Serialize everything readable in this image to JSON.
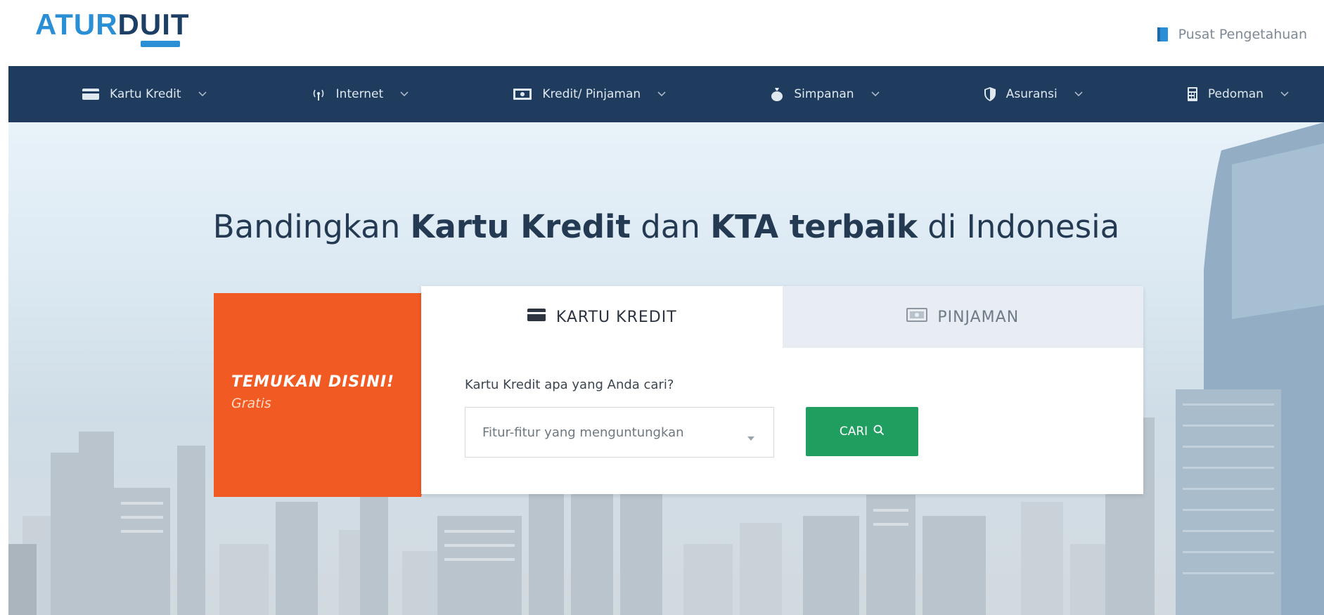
{
  "brand": {
    "logo_part1": "ATUR",
    "logo_part2": "DUIT",
    "link_label": "Pusat Pengetahuan"
  },
  "nav": {
    "items": [
      {
        "label": "Kartu Kredit",
        "icon": "credit-card-icon"
      },
      {
        "label": "Internet",
        "icon": "wifi-signal-icon"
      },
      {
        "label": "Kredit/ Pinjaman",
        "icon": "cash-icon"
      },
      {
        "label": "Simpanan",
        "icon": "money-bag-icon"
      },
      {
        "label": "Asuransi",
        "icon": "shield-icon"
      },
      {
        "label": "Pedoman",
        "icon": "calculator-icon"
      }
    ]
  },
  "hero": {
    "title_pre": "Bandingkan ",
    "title_bold1": "Kartu Kredit",
    "title_mid": " dan ",
    "title_bold2": "KTA terbaik",
    "title_post": " di Indonesia"
  },
  "search": {
    "banner_title": "TEMUKAN DISINI!",
    "banner_sub": "Gratis",
    "tabs": [
      {
        "label": "KARTU KREDIT",
        "icon": "credit-card-icon",
        "active": true
      },
      {
        "label": "PINJAMAN",
        "icon": "cash-icon",
        "active": false
      }
    ],
    "question": "Kartu Kredit apa yang Anda cari?",
    "select_value": "Fitur-fitur yang menguntungkan",
    "button_label": "CARI"
  },
  "colors": {
    "nav_bg": "#1f3c5e",
    "accent_orange": "#f15a22",
    "button_green": "#1f9e60",
    "logo_blue": "#2b8fd6",
    "logo_navy": "#1d3f66"
  }
}
